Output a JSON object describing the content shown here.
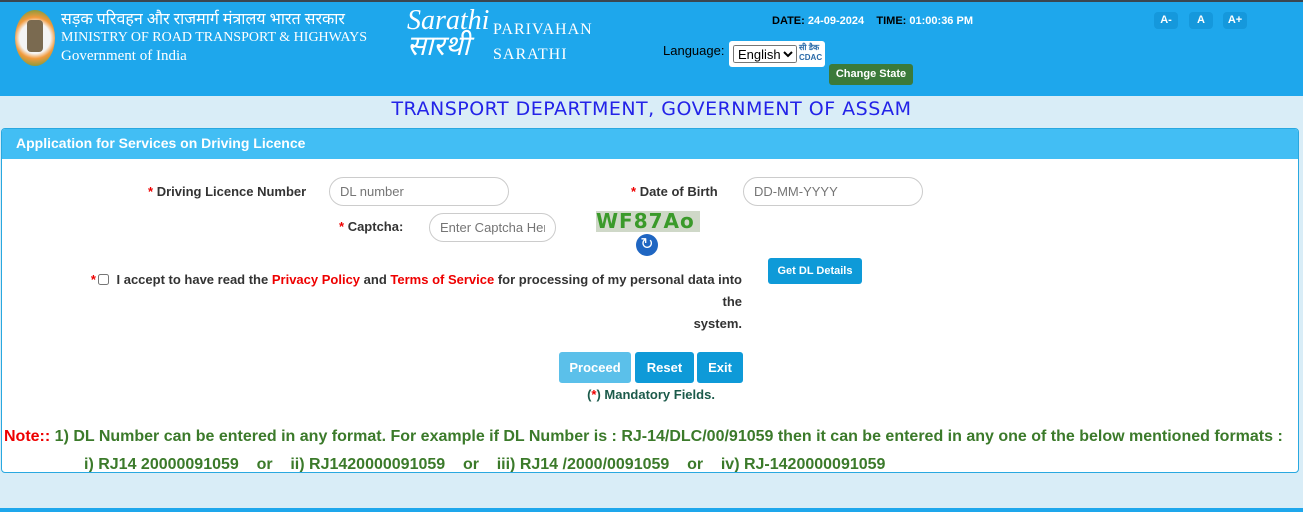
{
  "header": {
    "ministry_hindi": "सड़क परिवहन और राजमार्ग मंत्रालय भारत सरकार",
    "ministry_english": "MINISTRY OF ROAD TRANSPORT & HIGHWAYS",
    "government": "Government of India",
    "logo_text": "Sarathi सारथी",
    "brand_line1": "PARIVAHAN",
    "brand_line2": "SARATHI",
    "date_label": "DATE:",
    "date_value": "24-09-2024",
    "time_label": "TIME:",
    "time_value": "01:00:36 PM",
    "font_decrease": "A-",
    "font_normal": "A",
    "font_increase": "A+",
    "language_label": "Language:",
    "language_selected": "English",
    "cdac_logo": "सी डैक CDAC",
    "change_state": "Change State"
  },
  "page_title": "TRANSPORT DEPARTMENT, GOVERNMENT OF ASSAM",
  "form": {
    "heading": "Application for Services on Driving Licence",
    "required_mark": "*",
    "dl_label": "Driving Licence Number",
    "dl_placeholder": "DL number",
    "dob_label": "Date of Birth",
    "dob_placeholder": "DD-MM-YYYY",
    "captcha_label": "Captcha:",
    "captcha_placeholder": "Enter Captcha Here",
    "captcha_image_text": "WF87Ao",
    "accept_text1": "I accept to have read the",
    "privacy_policy": "Privacy Policy",
    "and": "and",
    "terms": "Terms of Service",
    "accept_text2": "for processing of my personal data into the",
    "accept_text3": "system.",
    "get_dl_details": "Get DL Details",
    "proceed": "Proceed",
    "reset": "Reset",
    "exit": "Exit",
    "mandatory_open": "(",
    "mandatory_close": ") Mandatory Fields."
  },
  "note": {
    "label": "Note::",
    "line1": "1) DL Number can be entered in any format. For example if DL Number is : RJ-14/DLC/00/91059 then it can be entered in any one of the below mentioned formats :",
    "line2": "i) RJ14 20000091059    or    ii) RJ1420000091059    or    iii) RJ14 /2000/0091059    or    iv) RJ-1420000091059"
  },
  "colors": {
    "header_bg": "#1ea7ec",
    "panel_heading": "#42bef4",
    "button": "#0e9ad8",
    "change_state": "#3b7a3a",
    "note_text": "#3b7a2a"
  }
}
